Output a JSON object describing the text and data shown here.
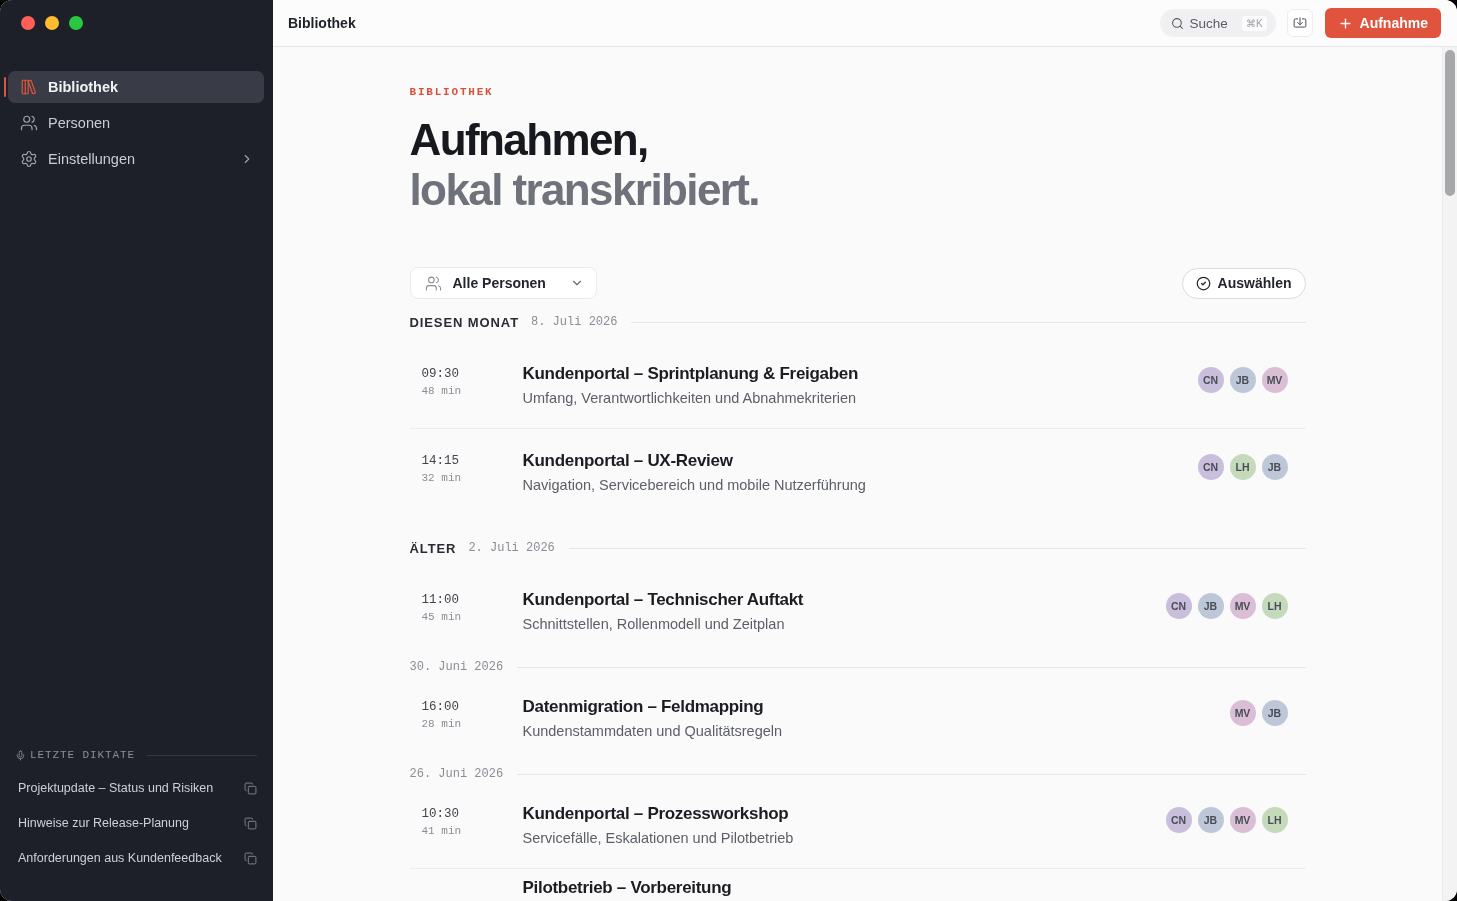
{
  "sidebar": {
    "nav": [
      {
        "label": "Bibliothek",
        "selected": true,
        "kind": "link"
      },
      {
        "label": "Personen",
        "selected": false,
        "kind": "link"
      },
      {
        "label": "Einstellungen",
        "selected": false,
        "kind": "submenu"
      }
    ],
    "recent": {
      "title": "LETZTE DIKTATE",
      "items": [
        "Projektupdate – Status und Risiken",
        "Hinweise zur Release-Planung",
        "Anforderungen aus Kundenfeedback"
      ]
    }
  },
  "topbar": {
    "title": "Bibliothek",
    "search": {
      "label": "Suche",
      "shortcut": "⌘K"
    },
    "record_button": "Aufnahme"
  },
  "page": {
    "eyebrow": "BIBLIOTHEK",
    "title": "Aufnahmen,",
    "subtitle": "lokal transkribiert."
  },
  "filters": {
    "people_dropdown": "Alle Personen",
    "select_button": "Auswählen"
  },
  "sections": [
    {
      "label": "DIESEN MONAT",
      "days": [
        {
          "date": "8. Juli 2026",
          "recordings": [
            {
              "time": "09:30",
              "duration": "48 min",
              "title": "Kundenportal – Sprintplanung & Freigaben",
              "subtitle": "Umfang, Verantwortlichkeiten und Abnahmekriterien",
              "people": [
                {
                  "initials": "CN",
                  "color": "#c9bedb"
                },
                {
                  "initials": "JB",
                  "color": "#bec7d8"
                },
                {
                  "initials": "MV",
                  "color": "#d9bed6"
                }
              ]
            },
            {
              "time": "14:15",
              "duration": "32 min",
              "title": "Kundenportal – UX-Review",
              "subtitle": "Navigation, Servicebereich und mobile Nutzerführung",
              "people": [
                {
                  "initials": "CN",
                  "color": "#c9bedb"
                },
                {
                  "initials": "LH",
                  "color": "#c4dabb"
                },
                {
                  "initials": "JB",
                  "color": "#bec7d8"
                }
              ]
            }
          ]
        }
      ]
    },
    {
      "label": "ÄLTER",
      "days": [
        {
          "date": "2. Juli 2026",
          "recordings": [
            {
              "time": "11:00",
              "duration": "45 min",
              "title": "Kundenportal – Technischer Auftakt",
              "subtitle": "Schnittstellen, Rollenmodell und Zeitplan",
              "people": [
                {
                  "initials": "CN",
                  "color": "#c9bedb"
                },
                {
                  "initials": "JB",
                  "color": "#bec7d8"
                },
                {
                  "initials": "MV",
                  "color": "#d9bed6"
                },
                {
                  "initials": "LH",
                  "color": "#c4dabb"
                }
              ]
            }
          ]
        },
        {
          "date": "30. Juni 2026",
          "recordings": [
            {
              "time": "16:00",
              "duration": "28 min",
              "title": "Datenmigration – Feldmapping",
              "subtitle": "Kundenstammdaten und Qualitätsregeln",
              "people": [
                {
                  "initials": "MV",
                  "color": "#d9bed6"
                },
                {
                  "initials": "JB",
                  "color": "#bec7d8"
                }
              ]
            }
          ]
        },
        {
          "date": "26. Juni 2026",
          "recordings": [
            {
              "time": "10:30",
              "duration": "41 min",
              "title": "Kundenportal – Prozessworkshop",
              "subtitle": "Servicefälle, Eskalationen und Pilotbetrieb",
              "people": [
                {
                  "initials": "CN",
                  "color": "#c9bedb"
                },
                {
                  "initials": "JB",
                  "color": "#bec7d8"
                },
                {
                  "initials": "MV",
                  "color": "#d9bed6"
                },
                {
                  "initials": "LH",
                  "color": "#c4dabb"
                }
              ]
            },
            {
              "title": "Pilotbetrieb – Vorbereitung"
            }
          ]
        }
      ]
    }
  ]
}
